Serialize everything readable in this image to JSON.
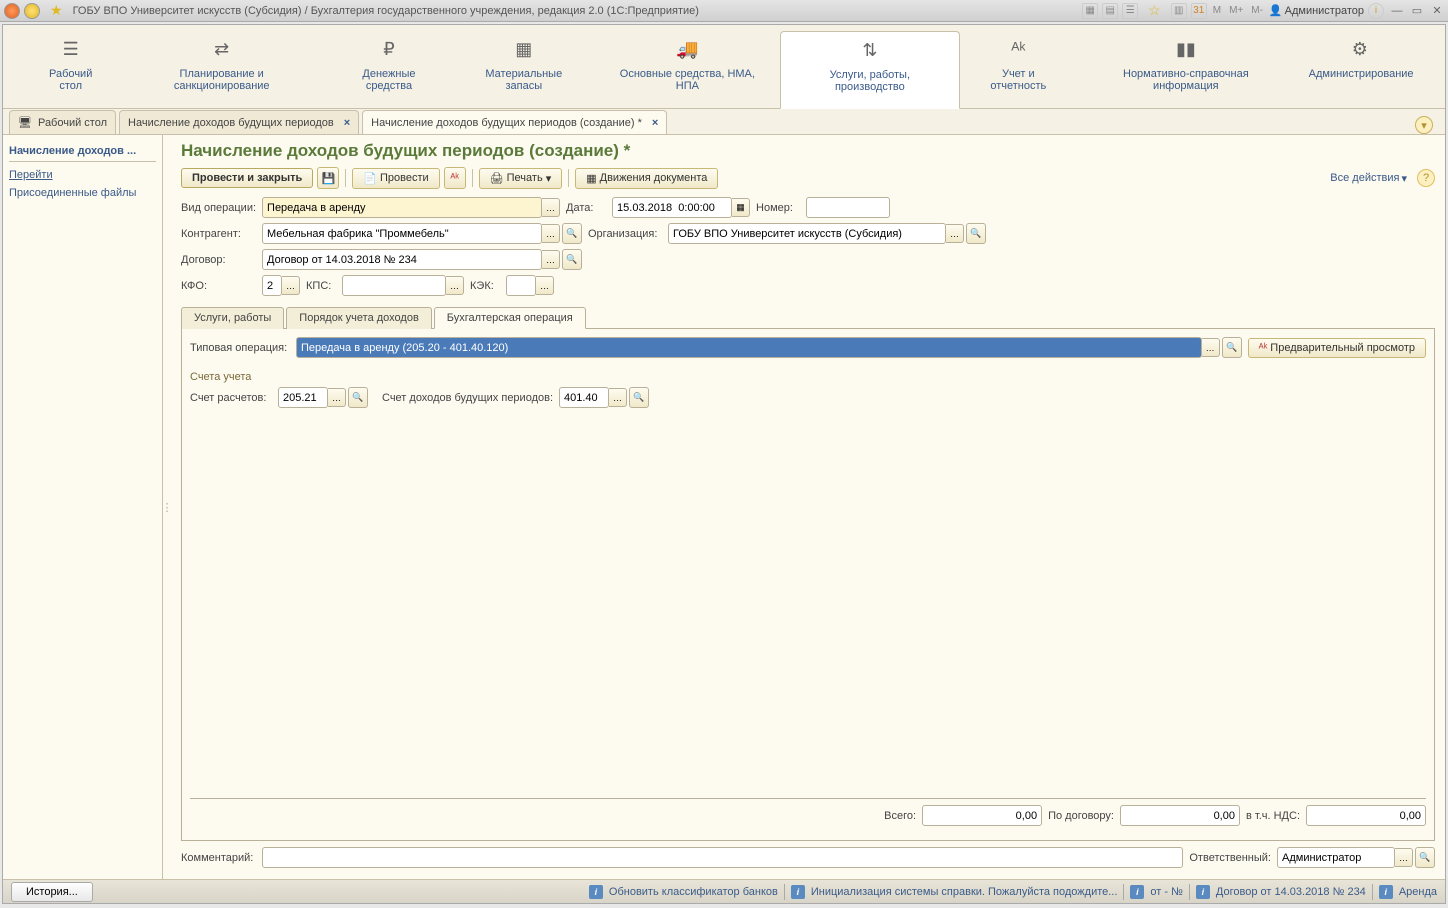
{
  "titlebar": {
    "title": "ГОБУ ВПО Университет искусств (Субсидия) / Бухгалтерия государственного учреждения, редакция 2.0  (1С:Предприятие)",
    "user": "Администратор",
    "m": "M",
    "mplus": "M+",
    "mminus": "M-"
  },
  "nav": {
    "desktop": "Рабочий стол",
    "planning": "Планирование и санкционирование",
    "money": "Денежные средства",
    "materials": "Материальные запасы",
    "assets": "Основные средства, НМА, НПА",
    "services": "Услуги, работы, производство",
    "accounting": "Учет и отчетность",
    "reference": "Нормативно-справочная информация",
    "admin": "Администрирование"
  },
  "tabs": {
    "t1": "Рабочий стол",
    "t2": "Начисление доходов будущих периодов",
    "t3": "Начисление доходов будущих периодов (создание) *"
  },
  "sidebar": {
    "title": "Начисление доходов ...",
    "goto": "Перейти",
    "files": "Присоединенные файлы"
  },
  "page": {
    "title": "Начисление доходов будущих периодов (создание) *",
    "post_close": "Провести и закрыть",
    "post": "Провести",
    "print": "Печать",
    "movements": "Движения документа",
    "all_actions": "Все действия"
  },
  "form": {
    "operation_lbl": "Вид операции:",
    "operation_val": "Передача в аренду",
    "date_lbl": "Дата:",
    "date_val": "15.03.2018  0:00:00",
    "number_lbl": "Номер:",
    "contractor_lbl": "Контрагент:",
    "contractor_val": "Мебельная фабрика \"Проммебель\"",
    "org_lbl": "Организация:",
    "org_val": "ГОБУ ВПО Университет искусств (Субсидия)",
    "contract_lbl": "Договор:",
    "contract_val": "Договор от 14.03.2018 № 234",
    "kfo_lbl": "КФО:",
    "kfo_val": "2",
    "kps_lbl": "КПС:",
    "kek_lbl": "КЭК:"
  },
  "subtabs": {
    "services": "Услуги, работы",
    "order": "Порядок учета доходов",
    "accounting": "Бухгалтерская операция"
  },
  "acct": {
    "typical_lbl": "Типовая операция:",
    "typical_val": "Передача в аренду (205.20 - 401.40.120)",
    "preview": "Предварительный просмотр",
    "accounts_lbl": "Счета учета",
    "calc_lbl": "Счет расчетов:",
    "calc_val": "205.21",
    "future_lbl": "Счет доходов будущих периодов:",
    "future_val": "401.40"
  },
  "totals": {
    "total_lbl": "Всего:",
    "total_val": "0,00",
    "contract_lbl": "По договору:",
    "contract_val": "0,00",
    "vat_lbl": "в т.ч. НДС:",
    "vat_val": "0,00"
  },
  "footer": {
    "comment_lbl": "Комментарий:",
    "resp_lbl": "Ответственный:",
    "resp_val": "Администратор"
  },
  "status": {
    "history": "История...",
    "update_banks": "Обновить классификатор банков",
    "init_help": "Инициализация системы справки. Пожалуйста подождите...",
    "from_no": "от - №",
    "contract_link": "Договор от 14.03.2018 № 234",
    "rent": "Аренда"
  }
}
